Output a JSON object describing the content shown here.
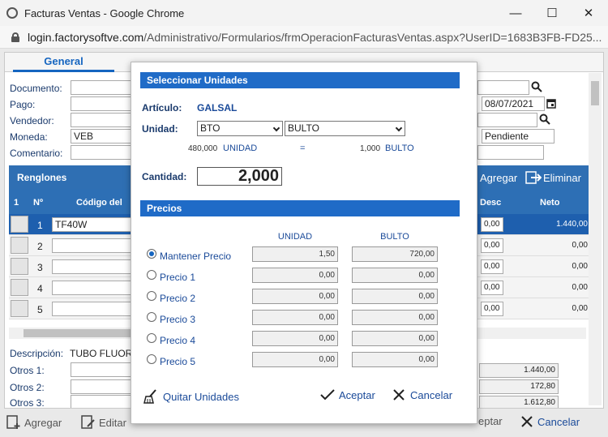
{
  "window": {
    "title": "Facturas Ventas - Google Chrome",
    "minimize_glyph": "—",
    "maximize_glyph": "☐",
    "close_glyph": "✕"
  },
  "address": {
    "host": "login.factorysoftve.com",
    "path": "/Administrativo/Formularios/frmOperacionFacturasVentas.aspx?UserID=1683B3FB-FD25..."
  },
  "page": {
    "tab_general": "General",
    "fields": {
      "documento_label": "Documento:",
      "pago_label": "Pago:",
      "vendedor_label": "Vendedor:",
      "moneda_label": "Moneda:",
      "moneda_value": "VEB",
      "comentario_label": "Comentario:",
      "fecha_value": "08/07/2021",
      "estatus_value": "Pendiente"
    },
    "renglones_label": "Renglones",
    "agregar_label": "Agregar",
    "eliminar_label": "Eliminar",
    "grid_columns": {
      "col1": "1",
      "num": "Nº",
      "codigo": "Código del",
      "desc": "Desc",
      "neto": "Neto"
    },
    "rows": [
      {
        "num": "1",
        "codigo": "TF40W",
        "desc": "0,00",
        "neto": "1.440,00"
      },
      {
        "num": "2",
        "codigo": "",
        "desc": "0,00",
        "neto": "0,00"
      },
      {
        "num": "3",
        "codigo": "",
        "desc": "0,00",
        "neto": "0,00"
      },
      {
        "num": "4",
        "codigo": "",
        "desc": "0,00",
        "neto": "0,00"
      },
      {
        "num": "5",
        "codigo": "",
        "desc": "0,00",
        "neto": "0,00"
      }
    ],
    "descripcion_label": "Descripción:",
    "descripcion_value": "TUBO FLUOR",
    "otros1_label": "Otros 1:",
    "otros2_label": "Otros 2:",
    "otros3_label": "Otros 3:",
    "totals": [
      "1.440,00",
      "172,80",
      "1.612,80"
    ]
  },
  "bottom": {
    "agregar": "Agregar",
    "editar": "Editar",
    "aceptar": "eptar",
    "cancelar": "Cancelar"
  },
  "modal": {
    "header_units": "Seleccionar Unidades",
    "articulo_label": "Artículo:",
    "articulo_value": "GALSAL",
    "unidad_label": "Unidad:",
    "unidad_code": "BTO",
    "unidad_name": "BULTO",
    "conv_qty1": "480,000",
    "conv_unit1": "UNIDAD",
    "conv_eq": "=",
    "conv_qty2": "1,000",
    "conv_unit2": "BULTO",
    "cantidad_label": "Cantidad:",
    "cantidad_value": "2,000",
    "header_precios": "Precios",
    "col_unidad": "UNIDAD",
    "col_bulto": "BULTO",
    "precios": [
      {
        "label": "Mantener Precio",
        "unidad": "1,50",
        "bulto": "720,00",
        "selected": true
      },
      {
        "label": "Precio 1",
        "unidad": "0,00",
        "bulto": "0,00",
        "selected": false
      },
      {
        "label": "Precio 2",
        "unidad": "0,00",
        "bulto": "0,00",
        "selected": false
      },
      {
        "label": "Precio 3",
        "unidad": "0,00",
        "bulto": "0,00",
        "selected": false
      },
      {
        "label": "Precio 4",
        "unidad": "0,00",
        "bulto": "0,00",
        "selected": false
      },
      {
        "label": "Precio 5",
        "unidad": "0,00",
        "bulto": "0,00",
        "selected": false
      }
    ],
    "quitar": "Quitar Unidades",
    "aceptar": "Aceptar",
    "cancelar": "Cancelar"
  }
}
